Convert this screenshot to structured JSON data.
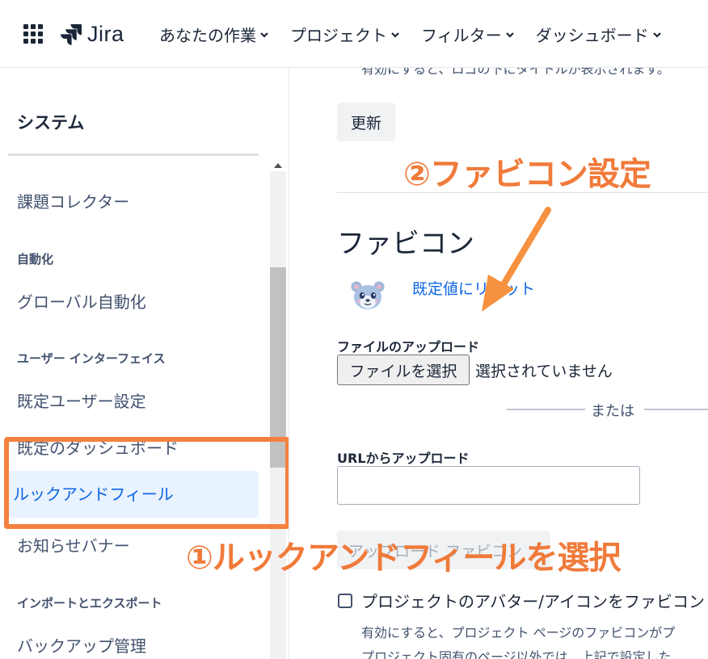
{
  "topnav": {
    "logo_text": "Jira",
    "items": [
      {
        "label": "あなたの作業"
      },
      {
        "label": "プロジェクト"
      },
      {
        "label": "フィルター"
      },
      {
        "label": "ダッシュボード"
      }
    ]
  },
  "sidebar": {
    "title": "システム",
    "items": {
      "issue_collector": "課題コレクター",
      "automation_header": "自動化",
      "global_automation": "グローバル自動化",
      "ui_header": "ユーザー インターフェイス",
      "default_user_settings": "既定ユーザー設定",
      "default_dashboard": "既定のダッシュボード",
      "look_and_feel": "ルックアンドフィール",
      "announcement_banner": "お知らせバナー",
      "import_export_header": "インポートとエクスポート",
      "backup_manager": "バックアップ管理"
    }
  },
  "main": {
    "cut_text": "有効にすると、ロゴの下にタイトルが表示されます。",
    "update_button": "更新",
    "section_title": "ファビコン",
    "reset_link": "既定値にリセット",
    "upload_label": "ファイルのアップロード",
    "file_button": "ファイルを選択",
    "file_status": "選択されていません",
    "or_text": "または",
    "url_label": "URLからアップロード",
    "url_value": "",
    "upload_favicon_button": "アップロード ファビコン",
    "checkbox_label": "プロジェクトのアバター/アイコンをファビコン",
    "help_line1": "有効にすると、プロジェクト ページのファビコンがプ",
    "help_line2": "プロジェクト固有のページ以外では、上記で設定した"
  },
  "annotations": {
    "step1": "①ルックアンドフィールを選択",
    "step2": "②ファビコン設定",
    "color": "#f07a3a"
  }
}
